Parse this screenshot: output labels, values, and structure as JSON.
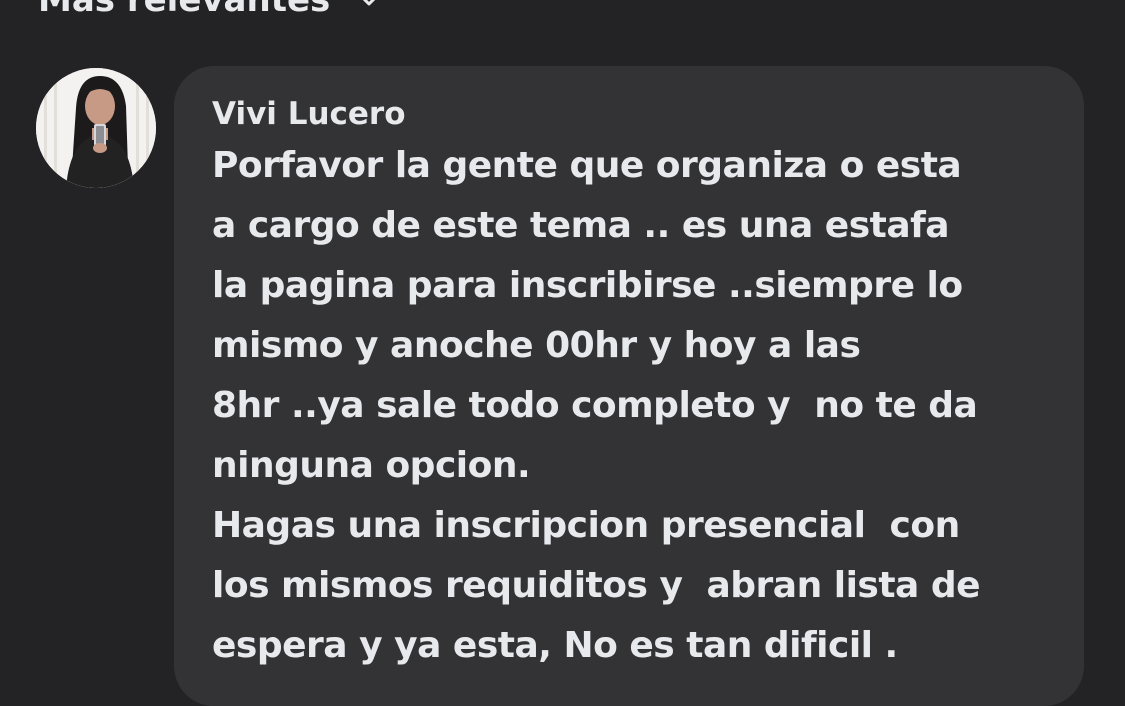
{
  "sort": {
    "label": "Más relevantes",
    "icon": "chevron-down-icon"
  },
  "comment": {
    "avatar_icon": "user-avatar-photo",
    "author": "Vivi Lucero",
    "lines": [
      "Porfavor la gente que organiza o esta",
      "a cargo de este tema .. es una estafa",
      "la pagina para inscribirse ..siempre lo",
      "mismo y anoche 00hr y hoy a las",
      "8hr ..ya sale todo completo y  no te da",
      "ninguna opcion.",
      "Hagas una inscripcion presencial  con",
      "los mismos requiditos y  abran lista de",
      "espera y ya esta, No es tan dificil ."
    ]
  },
  "colors": {
    "background": "#232325",
    "bubble": "#333336",
    "text": "#e8e9ed"
  }
}
